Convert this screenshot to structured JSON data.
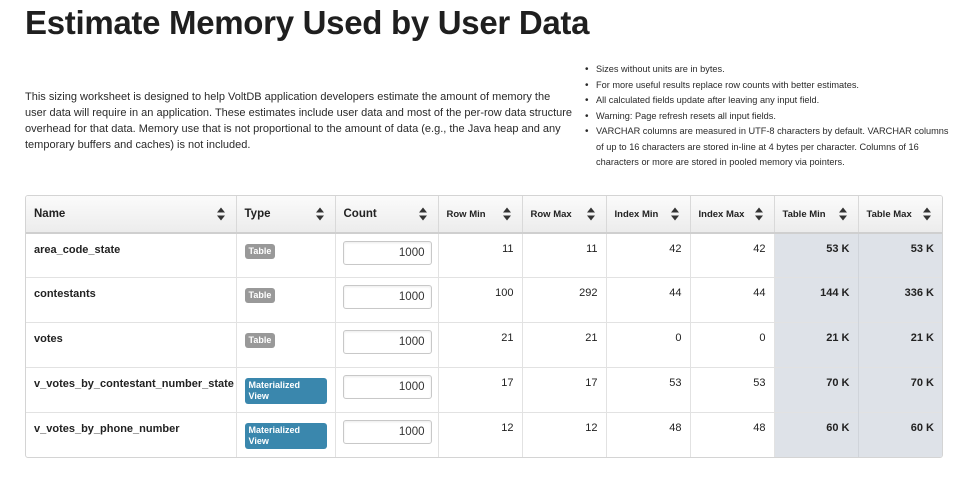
{
  "title": "Estimate Memory Used by User Data",
  "intro": "This sizing worksheet is designed to help VoltDB application developers estimate the amount of memory the user data will require in an application. These estimates include user data and most of the per-row data structure overhead for that data. Memory use that is not proportional to the amount of data (e.g., the Java heap and any temporary buffers and caches) is not included.",
  "notes": [
    "Sizes without units are in bytes.",
    "For more useful results replace row counts with better estimates.",
    "All calculated fields update after leaving any input field.",
    "Warning: Page refresh resets all input fields.",
    "VARCHAR columns are measured in UTF-8 characters by default. VARCHAR columns of up to 16 characters are stored in-line at 4 bytes per character. Columns of 16 characters or more are stored in pooled memory via pointers."
  ],
  "table": {
    "headers": [
      "Name",
      "Type",
      "Count",
      "Row Min",
      "Row Max",
      "Index Min",
      "Index Max",
      "Table Min",
      "Table Max"
    ],
    "rows": [
      {
        "name": "area_code_state",
        "type": "Table",
        "count": "1000",
        "row_min": "11",
        "row_max": "11",
        "index_min": "42",
        "index_max": "42",
        "table_min": "53 K",
        "table_max": "53 K"
      },
      {
        "name": "contestants",
        "type": "Table",
        "count": "1000",
        "row_min": "100",
        "row_max": "292",
        "index_min": "44",
        "index_max": "44",
        "table_min": "144 K",
        "table_max": "336 K"
      },
      {
        "name": "votes",
        "type": "Table",
        "count": "1000",
        "row_min": "21",
        "row_max": "21",
        "index_min": "0",
        "index_max": "0",
        "table_min": "21 K",
        "table_max": "21 K"
      },
      {
        "name": "v_votes_by_contestant_number_state",
        "type": "Materialized View",
        "count": "1000",
        "row_min": "17",
        "row_max": "17",
        "index_min": "53",
        "index_max": "53",
        "table_min": "70 K",
        "table_max": "70 K"
      },
      {
        "name": "v_votes_by_phone_number",
        "type": "Materialized View",
        "count": "1000",
        "row_min": "12",
        "row_max": "12",
        "index_min": "48",
        "index_max": "48",
        "table_min": "60 K",
        "table_max": "60 K"
      }
    ]
  },
  "colors": {
    "table_badge": "#999999",
    "view_badge": "#3a87ad",
    "total_column_bg": "#dee2e8"
  }
}
